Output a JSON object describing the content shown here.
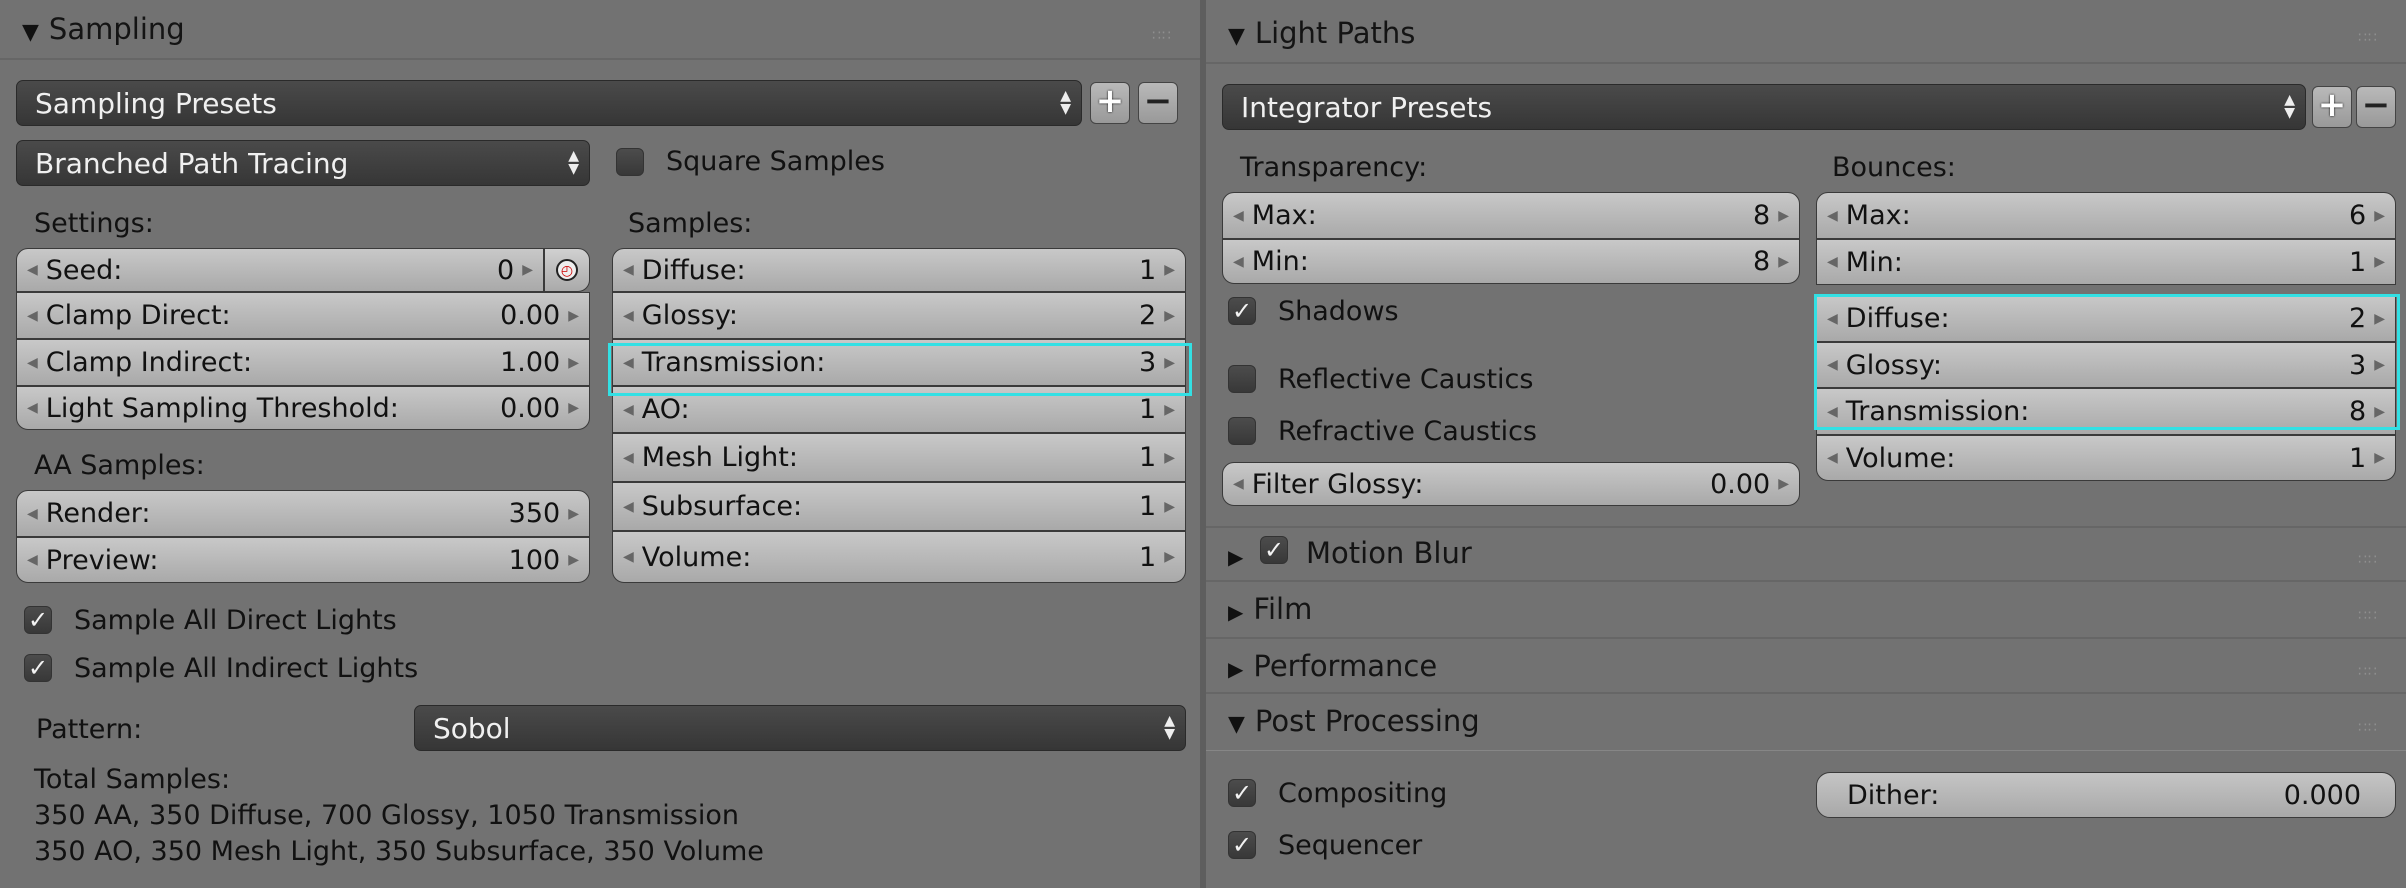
{
  "sampling": {
    "title": "Sampling",
    "presets_label": "Sampling Presets",
    "integrator": "Branched Path Tracing",
    "square_samples": {
      "label": "Square Samples",
      "checked": false
    },
    "settings_label": "Settings:",
    "samples_label": "Samples:",
    "settings": [
      {
        "name": "Seed:",
        "value": "0"
      },
      {
        "name": "Clamp Direct:",
        "value": "0.00"
      },
      {
        "name": "Clamp Indirect:",
        "value": "1.00"
      },
      {
        "name": "Light Sampling Threshold:",
        "value": "0.00"
      }
    ],
    "aa_label": "AA Samples:",
    "aa": [
      {
        "name": "Render:",
        "value": "350"
      },
      {
        "name": "Preview:",
        "value": "100"
      }
    ],
    "samples": [
      {
        "name": "Diffuse:",
        "value": "1"
      },
      {
        "name": "Glossy:",
        "value": "2"
      },
      {
        "name": "Transmission:",
        "value": "3"
      },
      {
        "name": "AO:",
        "value": "1"
      },
      {
        "name": "Mesh Light:",
        "value": "1"
      },
      {
        "name": "Subsurface:",
        "value": "1"
      },
      {
        "name": "Volume:",
        "value": "1"
      }
    ],
    "sample_all_direct": {
      "label": "Sample All Direct Lights",
      "checked": true
    },
    "sample_all_indirect": {
      "label": "Sample All Indirect Lights",
      "checked": true
    },
    "pattern_label": "Pattern:",
    "pattern_value": "Sobol",
    "total_label": "Total Samples:",
    "total_line1": "350 AA, 350 Diffuse, 700 Glossy, 1050 Transmission",
    "total_line2": "350 AO, 350 Mesh Light, 350 Subsurface, 350 Volume"
  },
  "light_paths": {
    "title": "Light Paths",
    "presets_label": "Integrator Presets",
    "transparency_label": "Transparency:",
    "transparency": [
      {
        "name": "Max:",
        "value": "8"
      },
      {
        "name": "Min:",
        "value": "8"
      }
    ],
    "bounces_label": "Bounces:",
    "bounces": [
      {
        "name": "Max:",
        "value": "6"
      },
      {
        "name": "Min:",
        "value": "1"
      },
      {
        "name": "Diffuse:",
        "value": "2"
      },
      {
        "name": "Glossy:",
        "value": "3"
      },
      {
        "name": "Transmission:",
        "value": "8"
      },
      {
        "name": "Volume:",
        "value": "1"
      }
    ],
    "shadows": {
      "label": "Shadows",
      "checked": true
    },
    "reflective_caustics": {
      "label": "Reflective Caustics",
      "checked": false
    },
    "refractive_caustics": {
      "label": "Refractive Caustics",
      "checked": false
    },
    "filter_glossy": {
      "name": "Filter Glossy:",
      "value": "0.00"
    }
  },
  "motion_blur": {
    "title": "Motion Blur",
    "checked": true
  },
  "film": {
    "title": "Film"
  },
  "performance": {
    "title": "Performance"
  },
  "post_processing": {
    "title": "Post Processing",
    "compositing": {
      "label": "Compositing",
      "checked": true
    },
    "sequencer": {
      "label": "Sequencer",
      "checked": true
    },
    "dither": {
      "name": "Dither:",
      "value": "0.000"
    }
  },
  "colors": {
    "highlight": "#33e0e4",
    "panel_bg": "#727272"
  }
}
